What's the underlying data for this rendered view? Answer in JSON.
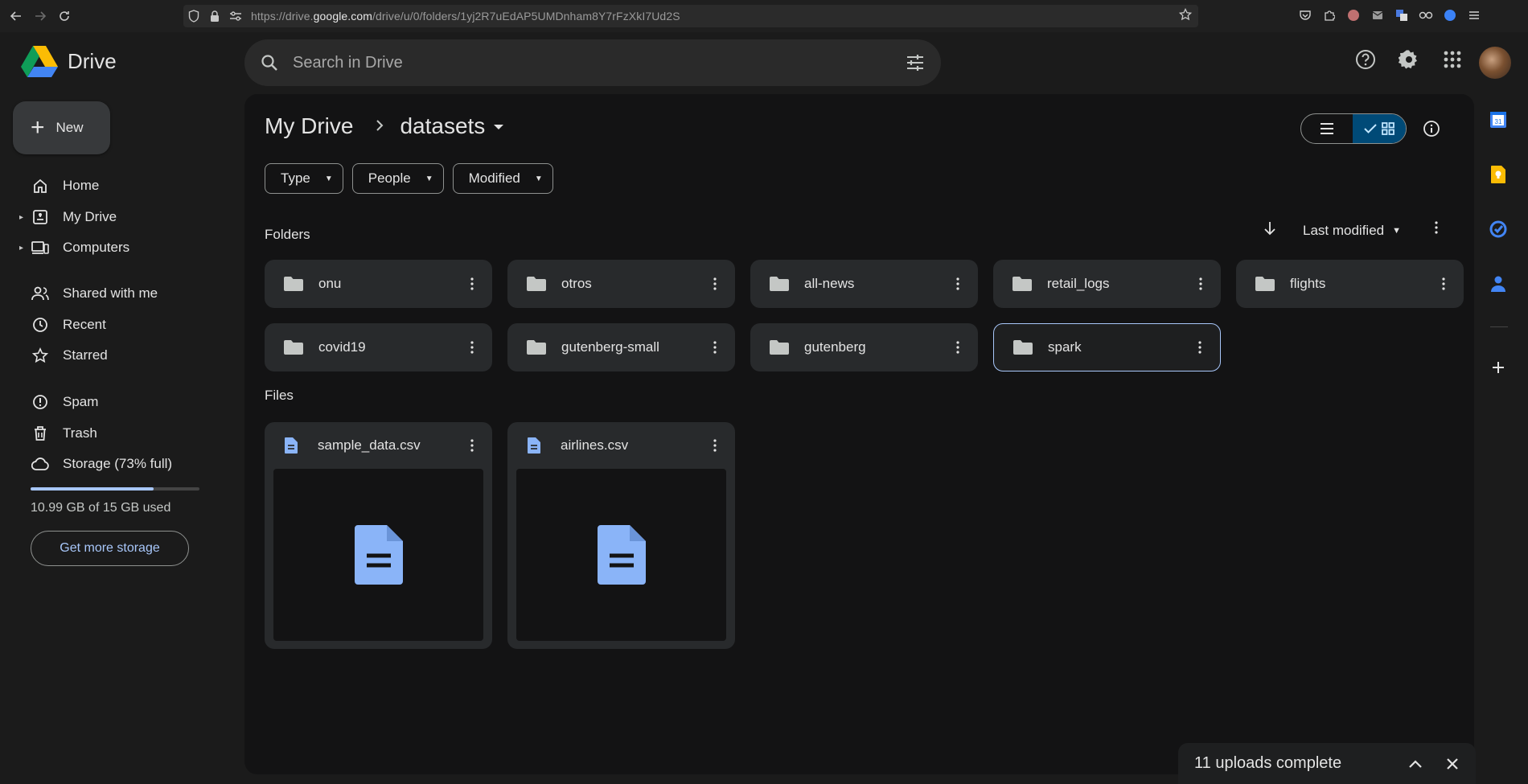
{
  "browser": {
    "url_prefix": "https://drive.",
    "url_domain": "google.com",
    "url_path": "/drive/u/0/folders/1yj2R7uEdAP5UMDnham8Y7rFzXkI7Ud2S"
  },
  "app": {
    "name": "Drive"
  },
  "search": {
    "placeholder": "Search in Drive"
  },
  "sidebar": {
    "new_label": "New",
    "items": [
      {
        "label": "Home",
        "icon": "home-icon"
      },
      {
        "label": "My Drive",
        "icon": "my-drive-icon"
      },
      {
        "label": "Computers",
        "icon": "computers-icon"
      },
      {
        "label": "Shared with me",
        "icon": "shared-icon"
      },
      {
        "label": "Recent",
        "icon": "clock-icon"
      },
      {
        "label": "Starred",
        "icon": "star-icon"
      },
      {
        "label": "Spam",
        "icon": "spam-icon"
      },
      {
        "label": "Trash",
        "icon": "trash-icon"
      },
      {
        "label": "Storage (73% full)",
        "icon": "cloud-icon"
      }
    ],
    "storage": {
      "used_fraction": 0.73,
      "text": "10.99 GB of 15 GB used",
      "cta": "Get more storage"
    }
  },
  "breadcrumb": {
    "root": "My Drive",
    "current": "datasets"
  },
  "filters": [
    "Type",
    "People",
    "Modified"
  ],
  "sections": {
    "folders": "Folders",
    "files": "Files"
  },
  "sort": {
    "label": "Last modified"
  },
  "folders": [
    {
      "name": "onu"
    },
    {
      "name": "otros"
    },
    {
      "name": "all-news"
    },
    {
      "name": "retail_logs"
    },
    {
      "name": "flights"
    },
    {
      "name": "covid19"
    },
    {
      "name": "gutenberg-small"
    },
    {
      "name": "gutenberg"
    },
    {
      "name": "spark"
    }
  ],
  "files": [
    {
      "name": "sample_data.csv"
    },
    {
      "name": "airlines.csv"
    }
  ],
  "toast": {
    "title": "11 uploads complete"
  },
  "colors": {
    "accent": "#a8c7fa",
    "doc_blue": "#8ab4f8",
    "selected_toggle": "#004a77"
  }
}
